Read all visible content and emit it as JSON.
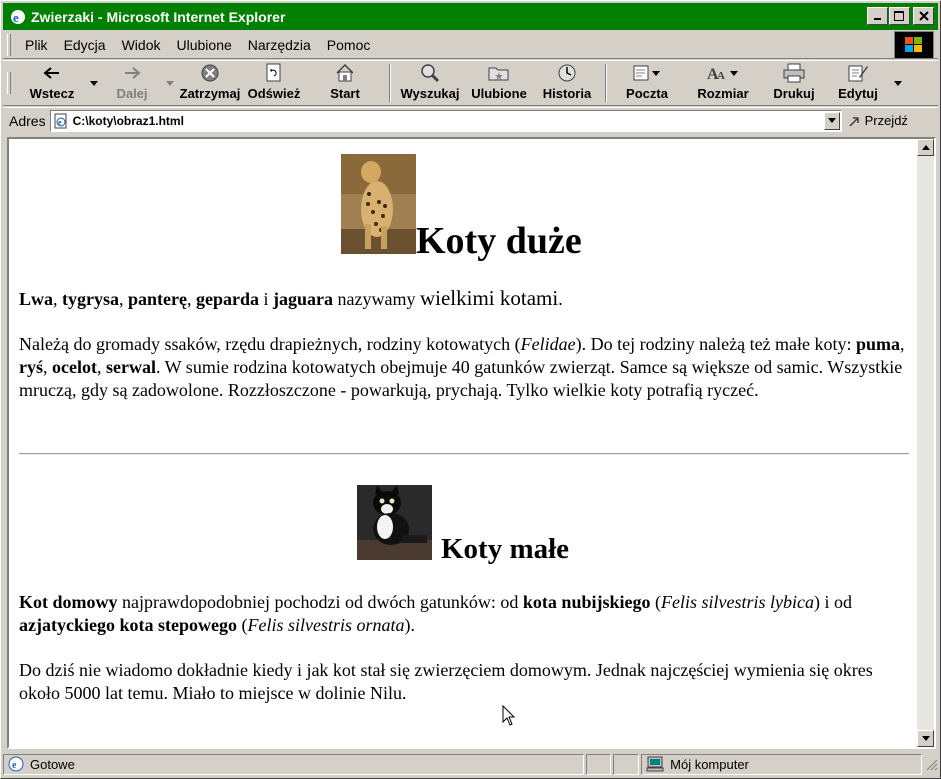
{
  "window": {
    "title": "Zwierzaki - Microsoft Internet Explorer",
    "minimize": "_",
    "maximize": "□",
    "close": "✕"
  },
  "menu": {
    "items": [
      "Plik",
      "Edycja",
      "Widok",
      "Ulubione",
      "Narzędzia",
      "Pomoc"
    ]
  },
  "toolbar": {
    "back": "Wstecz",
    "forward": "Dalej",
    "stop": "Zatrzymaj",
    "refresh": "Odśwież",
    "home": "Start",
    "search": "Wyszukaj",
    "favorites": "Ulubione",
    "history": "Historia",
    "mail": "Poczta",
    "size": "Rozmiar",
    "print": "Drukuj",
    "edit": "Edytuj"
  },
  "address": {
    "label": "Adres",
    "url": "C:\\koty\\obraz1.html",
    "go": "Przejdź"
  },
  "page": {
    "section1": {
      "heading": "Koty duże",
      "p1": {
        "b1": "Lwa",
        "s1": ", ",
        "b2": "tygrysa",
        "s2": ", ",
        "b3": "panterę",
        "s3": ", ",
        "b4": "geparda",
        "s4": " i ",
        "b5": "jaguara",
        "s5": " nazywamy ",
        "big": "wielkimi kotami",
        "end": "."
      },
      "p2": {
        "t1": "Należą do gromady ssaków, rzędu drapieżnych, rodziny kotowatych (",
        "i1": "Felidae",
        "t2": "). Do tej rodziny należą też małe koty: ",
        "b1": "puma",
        "s1": ", ",
        "b2": "ryś",
        "s2": ", ",
        "b3": "ocelot",
        "s3": ", ",
        "b4": "serwal",
        "t3": ". W sumie rodzina kotowatych obejmuje 40 gatunków zwierząt. Samce są większe od samic. Wszystkie mruczą, gdy są zadowolone. Rozzłoszczone - powarkują, prychają. Tylko wielkie koty potrafią ryczeć."
      }
    },
    "section2": {
      "heading": "Koty małe",
      "p1": {
        "b1": "Kot domowy",
        "t1": " najprawdopodobniej pochodzi od dwóch gatunków: od ",
        "b2": "kota nubijskiego",
        "t2": " (",
        "i1": "Felis silvestris lybica",
        "t3": ") i od ",
        "b3": "azjatyckiego kota stepowego",
        "t4": " (",
        "i2": "Felis silvestris ornata",
        "t5": ")."
      },
      "p2": "Do dziś nie wiadomo dokładnie kiedy i jak kot stał się zwierzęciem domowym. Jednak najczęściej wymienia się okres około 5000 lat temu. Miało to miejsce w dolinie Nilu."
    }
  },
  "status": {
    "text": "Gotowe",
    "zone": "Mój komputer"
  },
  "colors": {
    "titlebar": "#008000",
    "chrome": "#d4d0c8",
    "page": "#ffffff"
  }
}
